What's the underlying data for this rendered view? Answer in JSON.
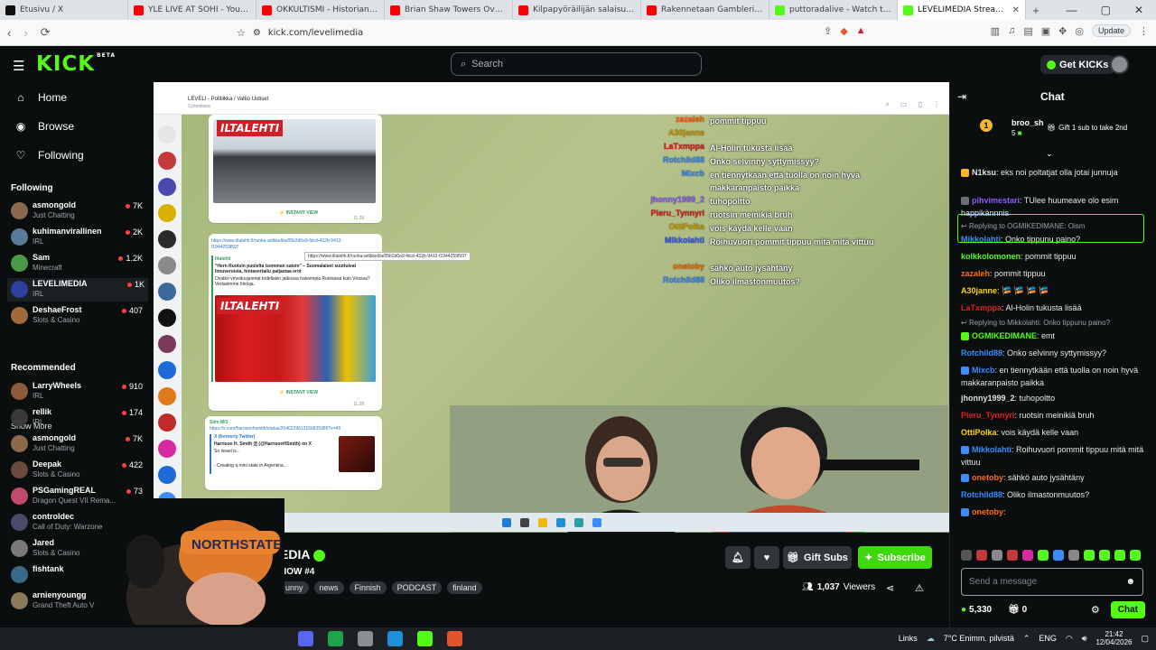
{
  "browser": {
    "tabs": [
      {
        "label": "Etusivu / X",
        "color": "#111111"
      },
      {
        "label": "YLE LIVE AT SOHI - YouTube",
        "color": "#ff0000"
      },
      {
        "label": "OKKULTISMI - Historian hylätty",
        "color": "#ff0000"
      },
      {
        "label": "Brian Shaw Towers Over Bodyb",
        "color": "#ff0000"
      },
      {
        "label": "Kilpapyöräilijän salaisuudet: Mi",
        "color": "#ff0000"
      },
      {
        "label": "Rakennetaan Gamblerin Täyd",
        "color": "#ff0000"
      },
      {
        "label": "puttoradalive - Watch the VOD",
        "color": "#53fc18"
      },
      {
        "label": "LEVELIMEDIA Stream -",
        "color": "#53fc18",
        "active": true
      }
    ],
    "url": "kick.com/levelimedia",
    "update_label": "Update"
  },
  "header": {
    "logo": "KICK",
    "logo_sup": "BETA",
    "search_placeholder": "Search",
    "get_kicks": "Get KICKs"
  },
  "sidebar": {
    "nav": [
      {
        "label": "Home",
        "icon": "home-icon"
      },
      {
        "label": "Browse",
        "icon": "compass-icon"
      },
      {
        "label": "Following",
        "icon": "heart-icon"
      }
    ],
    "following_title": "Following",
    "following": [
      {
        "name": "asmongold",
        "category": "Just Chatting",
        "viewers": "7K",
        "color": "#8a6a4a"
      },
      {
        "name": "kuhimanvirallinen",
        "category": "IRL",
        "viewers": "2K",
        "color": "#5a7a9a"
      },
      {
        "name": "Sam",
        "category": "Minecraft",
        "viewers": "1.2K",
        "color": "#4a9a4a"
      },
      {
        "name": "LEVELIMEDIA",
        "category": "IRL",
        "viewers": "1K",
        "color": "#2b3fa0",
        "selected": true
      },
      {
        "name": "DeshaeFrost",
        "category": "Slots & Casino",
        "viewers": "407",
        "color": "#a06a3a"
      }
    ],
    "show_more": "Show More",
    "recommended_title": "Recommended",
    "recommended": [
      {
        "name": "LarryWheels",
        "category": "IRL",
        "viewers": "910",
        "color": "#8a5a3a"
      },
      {
        "name": "rellik",
        "category": "IRL",
        "viewers": "174",
        "color": "#3a3a3a"
      },
      {
        "name": "asmongold",
        "category": "Just Chatting",
        "viewers": "7K",
        "color": "#8a6a4a"
      },
      {
        "name": "Deepak",
        "category": "Slots & Casino",
        "viewers": "422",
        "color": "#6a4a3a"
      },
      {
        "name": "PSGamingREAL",
        "category": "Dragon Quest VII Rema...",
        "viewers": "73",
        "color": "#c04a6a"
      },
      {
        "name": "controldec",
        "category": "Call of Duty: Warzone",
        "viewers": "44",
        "color": "#4a4a6a"
      },
      {
        "name": "Jared",
        "category": "Slots & Casino",
        "viewers": "",
        "color": "#7a7a7a"
      },
      {
        "name": "fishtank",
        "category": "",
        "viewers": "",
        "color": "#3a6a8a"
      },
      {
        "name": "arnienyoungg",
        "category": "Grand Theft Auto V",
        "viewers": "",
        "color": "#8a7a5a"
      }
    ]
  },
  "stream_screen": {
    "tg_title": "LEVELI - Politiikka / Valtio Uutiset",
    "tg_subtitle": "3 members",
    "ilta_label": "ILTALEHTI",
    "instant_view": "⚡ INSTANT VIEW",
    "time1": "11:28",
    "time2": "11:28",
    "link1": "https://www.iltalehti.fi/ruoka-artikkeli/a/05b2d0a9-fdcd-432b-9412-f1944259f597",
    "tooltip": "https://www.iltalehti.fi/ruoka-artikkeli/a/05b2d0a9-fdcd-432b-9412-f1944259f597",
    "article_src": "Iltalehti",
    "article_title": "\"Hern Ruotsin puolelta isomman satsin\" – Suomalaiset suuttuivat limuveroista, hintavertailu paljastaa erot",
    "article_body": "Ovatko virvoitusjuomat todellakin jatkossa halvempia Ruotsissa kuin Virossa? Vertasimme hintoja.",
    "sender": "Slim Mi3",
    "link2": "https://x.com/harrisonhsmith/status/2040229612156825985?s=46",
    "x_source": "X (formerly Twitter)",
    "x_title": "Harrison H. Smith 🇾 (@HarrisonHSmith) on X",
    "x_line1": "So Israel is...",
    "x_line2": "- Creating a mini state in Argentina..."
  },
  "overlay_chat": [
    {
      "user": "zazaleh",
      "msg": "pommit tippuu",
      "color": "#ff6a00"
    },
    {
      "user": "A30janne",
      "msg": "",
      "color": "#c8a000"
    },
    {
      "user": "LaTxmppa",
      "msg": "Al-Holin tukusta lisää",
      "color": "#e02020"
    },
    {
      "user": "Rotchild88",
      "msg": "Onko selvinny syttymissyy?",
      "color": "#3a8cff"
    },
    {
      "user": "Mixcb",
      "msg": "en tiennytkään että tuolla on noin hyvä makkaranpaisto paikka",
      "color": "#3a8cff"
    },
    {
      "user": "jhonny1999_2",
      "msg": "tuhopoltto",
      "color": "#8a5cff"
    },
    {
      "user": "Pieru_Tynnyri",
      "msg": "ruotsin meinikiä bruh",
      "color": "#e02020"
    },
    {
      "user": "OttiPolka",
      "msg": "vois käydä kelle vaan",
      "color": "#c8a000"
    },
    {
      "user": "Mikkolahti",
      "msg": "Roihuvuori pommit tippuu mitä mitä vittuu",
      "color": "#3a5cff"
    },
    {
      "user": "onetoby",
      "msg": "sähkö auto jysähtäny",
      "color": "#ff6a00"
    },
    {
      "user": "Rotchild88",
      "msg": "Oliko ilmastonmuutos?",
      "color": "#3a8cff"
    }
  ],
  "stream_info": {
    "title_suffix": "EDIA",
    "subtitle_suffix": "HOW #4",
    "tags": [
      "unny",
      "news",
      "Finnish",
      "PODCAST",
      "finland"
    ],
    "gift_subs": "Gift Subs",
    "subscribe": "Subscribe",
    "viewers": "1,037",
    "viewers_label": "Viewers"
  },
  "chat": {
    "title": "Chat",
    "gifter_name": "broo_sh",
    "gifter_count": "5",
    "gift_text": "Gift 1 sub to take 2nd",
    "messages": [
      {
        "kind": "msg",
        "user": "N1ksu",
        "text": "eks noi poltatjat olla jotai junnuja",
        "color": "#e0e0e0",
        "badge": "#f6b728"
      },
      {
        "kind": "msg",
        "user": "pihvimestari",
        "text": "TUlee huumeave olo esim happikännnis",
        "color": "#8a5cff",
        "badge": "#6a6f73"
      },
      {
        "kind": "reply",
        "text": "Replying to OGMIKEDIMANE: Oism"
      },
      {
        "kind": "msg",
        "user": "Mikkolahti",
        "text": "Onko tippunu paino?",
        "color": "#3a8cff",
        "badge": ""
      },
      {
        "kind": "msg",
        "user": "kolkkolomonen",
        "text": "pommit tippuu",
        "color": "#53fc18",
        "badge": ""
      },
      {
        "kind": "msg",
        "user": "zazaleh",
        "text": "pommit tippuu",
        "color": "#ff6a00",
        "badge": ""
      },
      {
        "kind": "msg",
        "user": "A30janne",
        "text": "🎏 🎏 🎏 🎏",
        "color": "#ffd400",
        "badge": ""
      },
      {
        "kind": "msg",
        "user": "LaTxmppa",
        "text": "Al-Holin tukusta lisää",
        "color": "#e02020",
        "badge": ""
      },
      {
        "kind": "reply",
        "text": "Replying to Mikkolahti: Onko tippunu paino?"
      },
      {
        "kind": "msg",
        "user": "OGMIKEDIMANE",
        "text": "emt",
        "color": "#53fc18",
        "badge": "#53fc18"
      },
      {
        "kind": "msg",
        "user": "Rotchild88",
        "text": "Onko selvinny syttymissyy?",
        "color": "#3a8cff",
        "badge": ""
      },
      {
        "kind": "msg",
        "user": "Mixcb",
        "text": "en tiennytkään että tuolla on noin hyvä makkaranpaisto paikka",
        "color": "#3a8cff",
        "badge": "#3a8cff"
      },
      {
        "kind": "msg",
        "user": "jhonny1999_2",
        "text": "tuhopoltto",
        "color": "#e0e0e0",
        "badge": ""
      },
      {
        "kind": "msg",
        "user": "Pieru_Tynnyri",
        "text": "ruotsin meinikiä bruh",
        "color": "#e02020",
        "badge": ""
      },
      {
        "kind": "msg",
        "user": "OttiPolka",
        "text": "vois käydä kelle vaan",
        "color": "#ffd400",
        "badge": ""
      },
      {
        "kind": "msg",
        "user": "Mikkolahti",
        "text": "Roihuvuori pommit tippuu mitä mitä vittuu",
        "color": "#3a8cff",
        "badge": "#3a8cff"
      },
      {
        "kind": "msg",
        "user": "onetoby",
        "text": "sähkö auto jysähtäny",
        "color": "#ff6a00",
        "badge": "#3a8cff"
      },
      {
        "kind": "msg",
        "user": "Rotchild88",
        "text": "Oliko ilmastonmuutos?",
        "color": "#3a8cff",
        "badge": ""
      },
      {
        "kind": "msg",
        "user": "onetoby",
        "text": "",
        "color": "#ff6a00",
        "badge": "#3a8cff"
      }
    ],
    "input_placeholder": "Send a message",
    "kicks": "5,330",
    "gifts": "0",
    "chat_button": "Chat"
  },
  "taskbar": {
    "links": "Links",
    "weather": "7°C  Enimm. pilvistä",
    "lang": "ENG",
    "time": "21:42",
    "date": "12/04/2026"
  }
}
